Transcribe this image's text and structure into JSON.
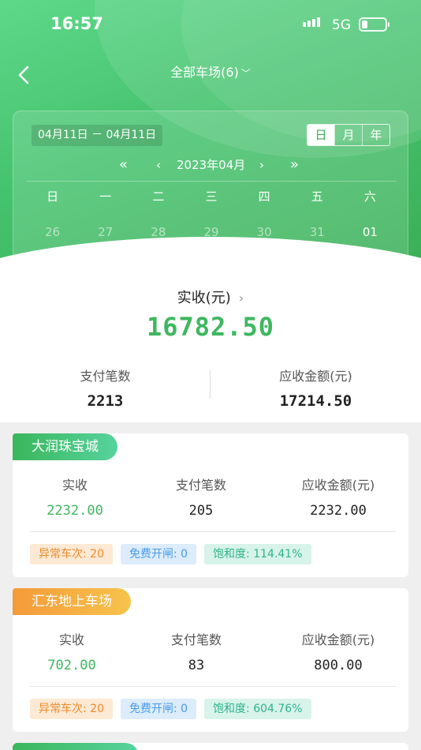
{
  "status_bar": {
    "time": "16:57",
    "network": "5G"
  },
  "nav": {
    "title": "全部车场(6)"
  },
  "calendar": {
    "date_range": "04月11日 － 04月11日",
    "modes": [
      "日",
      "月",
      "年"
    ],
    "active_mode": "日",
    "month_label": "2023年04月",
    "weekdays": [
      "日",
      "一",
      "二",
      "三",
      "四",
      "五",
      "六"
    ],
    "days": [
      "26",
      "27",
      "28",
      "29",
      "30",
      "31",
      "01"
    ]
  },
  "summary": {
    "title": "实收(元)",
    "value": "16782.50",
    "payments_label": "支付笔数",
    "payments_value": "2213",
    "receivable_label": "应收金额(元)",
    "receivable_value": "17214.50"
  },
  "lots": [
    {
      "name": "大润珠宝城",
      "received_label": "实收",
      "received": "2232.00",
      "payments_label": "支付笔数",
      "payments": "205",
      "receivable_label": "应收金额(元)",
      "receivable": "2232.00",
      "abnormal": "异常车次: 20",
      "free_open": "免费开闸: 0",
      "saturation": "饱和度: 114.41%"
    },
    {
      "name": "汇东地上车场",
      "received_label": "实收",
      "received": "702.00",
      "payments_label": "支付笔数",
      "payments": "83",
      "receivable_label": "应收金额(元)",
      "receivable": "800.00",
      "abnormal": "异常车次: 20",
      "free_open": "免费开闸: 0",
      "saturation": "饱和度: 604.76%"
    }
  ],
  "colors": {
    "brand_green": "#3fb760",
    "tag_orange": "#f59a3a"
  }
}
